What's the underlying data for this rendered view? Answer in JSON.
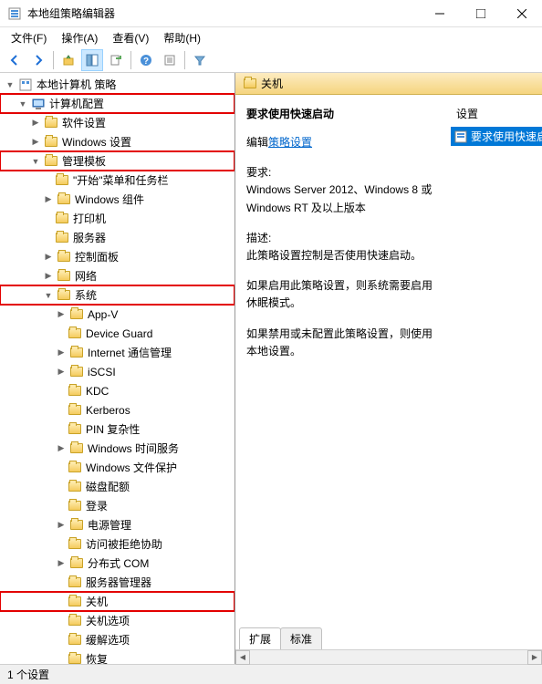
{
  "title": "本地组策略编辑器",
  "menus": {
    "file": "文件(F)",
    "action": "操作(A)",
    "view": "查看(V)",
    "help": "帮助(H)"
  },
  "tree": {
    "root": "本地计算机 策略",
    "computer_config": "计算机配置",
    "software_settings": "软件设置",
    "windows_settings": "Windows 设置",
    "admin_templates": "管理模板",
    "start_menu": "\"开始\"菜单和任务栏",
    "windows_components": "Windows 组件",
    "printer": "打印机",
    "server": "服务器",
    "control_panel": "控制面板",
    "network": "网络",
    "system": "系统",
    "app_v": "App-V",
    "device_guard": "Device Guard",
    "internet_comm": "Internet 通信管理",
    "iscsi": "iSCSI",
    "kdc": "KDC",
    "kerberos": "Kerberos",
    "pin_complexity": "PIN 复杂性",
    "windows_time": "Windows 时间服务",
    "windows_file_protect": "Windows 文件保护",
    "disk_quota": "磁盘配额",
    "logon": "登录",
    "power_mgmt": "电源管理",
    "access_denied": "访问被拒绝协助",
    "dcom": "分布式 COM",
    "server_mgr": "服务器管理器",
    "shutdown": "关机",
    "shutdown_options": "关机选项",
    "mitigation_options": "缓解选项",
    "recovery": "恢复"
  },
  "detail": {
    "header": "关机",
    "title": "要求使用快速启动",
    "edit_prefix": "编辑",
    "edit_link": "策略设置",
    "requirements_label": "要求:",
    "requirements_text": "Windows Server 2012、Windows 8 或 Windows RT 及以上版本",
    "description_label": "描述:",
    "description_text": "此策略设置控制是否使用快速启动。",
    "enabled_text": "如果启用此策略设置，则系统需要启用休眠模式。",
    "disabled_text": "如果禁用或未配置此策略设置，则使用本地设置。",
    "settings_header": "设置",
    "settings_item": "要求使用快速启",
    "tab_extended": "扩展",
    "tab_standard": "标准"
  },
  "statusbar": "1 个设置"
}
